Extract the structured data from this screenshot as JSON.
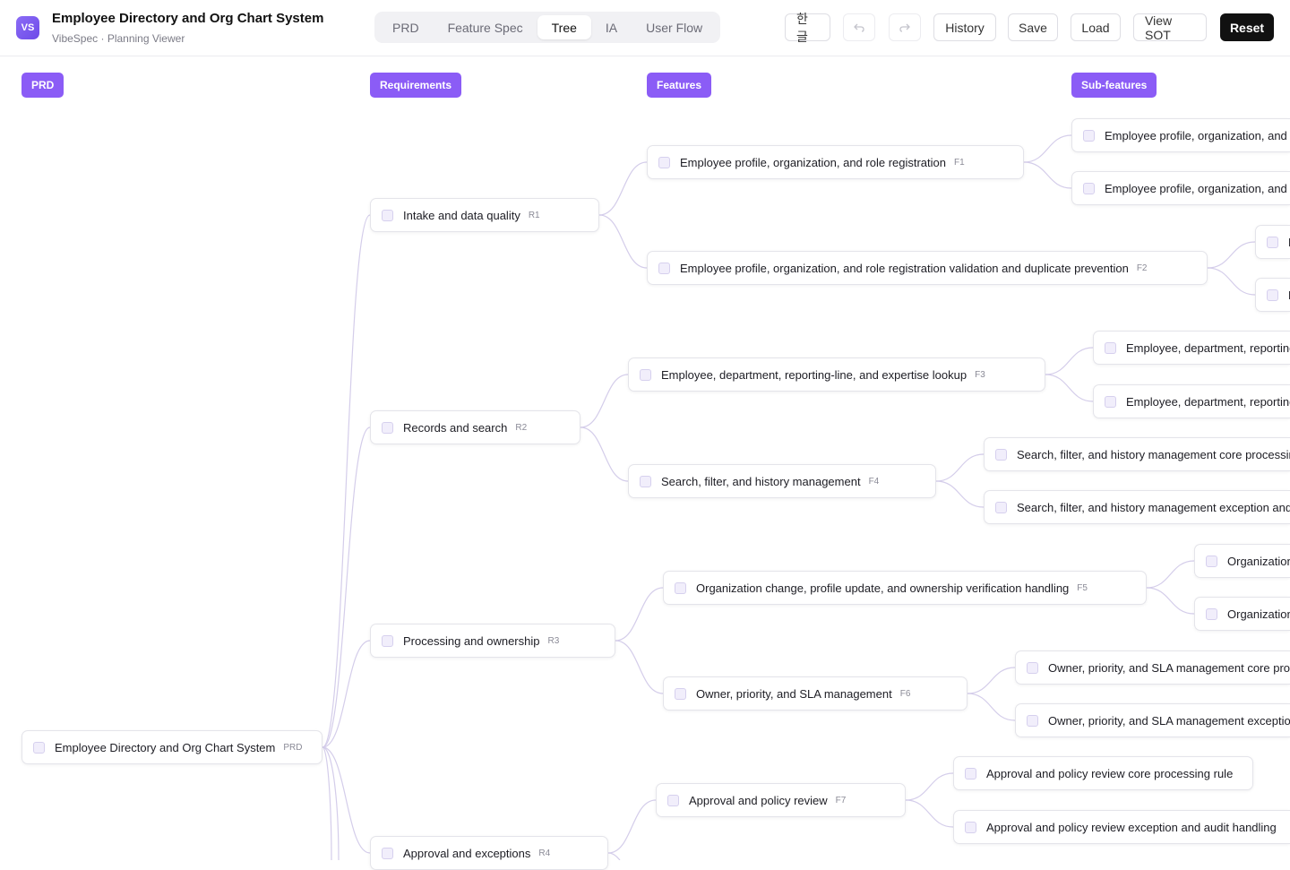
{
  "header": {
    "logo": "VS",
    "title": "Employee Directory and Org Chart System",
    "subtitle": "VibeSpec · Planning Viewer",
    "tabs": [
      {
        "label": "PRD"
      },
      {
        "label": "Feature Spec"
      },
      {
        "label": "Tree"
      },
      {
        "label": "IA"
      },
      {
        "label": "User Flow"
      }
    ],
    "active_tab": "Tree",
    "lang_label": "한글",
    "undo_icon": "undo-arrow-icon",
    "redo_icon": "redo-arrow-icon",
    "history_label": "History",
    "save_label": "Save",
    "load_label": "Load",
    "view_sot_label": "View SOT",
    "reset_label": "Reset"
  },
  "columns": {
    "prd": "PRD",
    "requirements": "Requirements",
    "features": "Features",
    "subfeatures": "Sub-features"
  },
  "tree": {
    "root": {
      "label": "Employee Directory and Org Chart System",
      "code": "PRD"
    },
    "requirements": [
      {
        "label": "Intake and data quality",
        "code": "R1"
      },
      {
        "label": "Records and search",
        "code": "R2"
      },
      {
        "label": "Processing and ownership",
        "code": "R3"
      },
      {
        "label": "Approval and exceptions",
        "code": "R4"
      }
    ],
    "features": [
      {
        "label": "Employee profile, organization, and role registration",
        "code": "F1"
      },
      {
        "label": "Employee profile, organization, and role registration validation and duplicate prevention",
        "code": "F2"
      },
      {
        "label": "Employee, department, reporting-line, and expertise lookup",
        "code": "F3"
      },
      {
        "label": "Search, filter, and history management",
        "code": "F4"
      },
      {
        "label": "Organization change, profile update, and ownership verification handling",
        "code": "F5"
      },
      {
        "label": "Owner, priority, and SLA management",
        "code": "F6"
      },
      {
        "label": "Approval and policy review",
        "code": "F7"
      }
    ],
    "subfeatures": [
      {
        "label": "Employee profile, organization, and r"
      },
      {
        "label": "Employee profile, organization, and r"
      },
      {
        "label": "E"
      },
      {
        "label": "E"
      },
      {
        "label": "Employee, department, reporting"
      },
      {
        "label": "Employee, department, reporting"
      },
      {
        "label": "Search, filter, and history management core processing"
      },
      {
        "label": "Search, filter, and history management exception and a"
      },
      {
        "label": "Organization"
      },
      {
        "label": "Organization"
      },
      {
        "label": "Owner, priority, and SLA management core proc"
      },
      {
        "label": "Owner, priority, and SLA management exception"
      },
      {
        "label": "Approval and policy review core processing rule"
      },
      {
        "label": "Approval and policy review exception and audit handling"
      }
    ]
  }
}
